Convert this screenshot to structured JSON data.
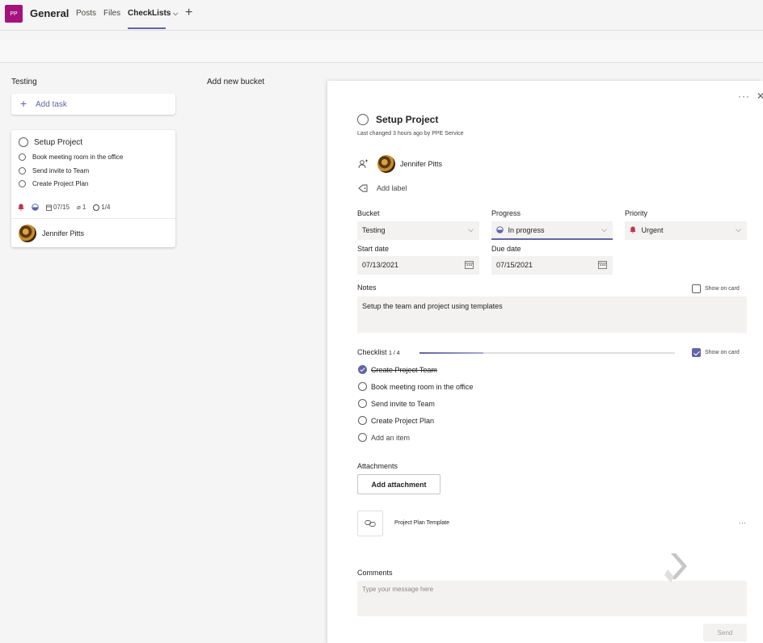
{
  "header": {
    "team_avatar": "PP",
    "team_name": "General",
    "tabs": [
      {
        "label": "Posts"
      },
      {
        "label": "Files"
      },
      {
        "label": "CheckLists"
      }
    ],
    "active_tab_chevron": "⌵",
    "add_tab": "+"
  },
  "board": {
    "bucket_name": "Testing",
    "add_bucket": "Add new bucket",
    "add_task": "Add task",
    "card": {
      "title": "Setup Project",
      "checklist": [
        "Book meeting room in the office",
        "Send invite to Team",
        "Create Project Plan"
      ],
      "due": "07/15",
      "attachments": "1",
      "checklist_count": "1/4",
      "assignee": "Jennifer Pitts"
    }
  },
  "panel": {
    "more": "···",
    "close": "✕",
    "title": "Setup Project",
    "subtitle": "Last changed 3 hours ago by PPE Service",
    "assignee": "Jennifer Pitts",
    "add_label": "Add label",
    "bucket_label": "Bucket",
    "bucket_value": "Testing",
    "progress_label": "Progress",
    "progress_value": "In progress",
    "priority_label": "Priority",
    "priority_value": "Urgent",
    "start_label": "Start date",
    "start_value": "07/13/2021",
    "due_label": "Due date",
    "due_value": "07/15/2021",
    "notes_label": "Notes",
    "show_on_card": "Show on card",
    "notes_value": "Setup the team and project using templates",
    "checklist_label": "Checklist",
    "checklist_count": "1 / 4",
    "checklist_progress": 0.25,
    "checklist_items": [
      {
        "label": "Create Project Team",
        "done": true
      },
      {
        "label": "Book meeting room in the office",
        "done": false
      },
      {
        "label": "Send invite to Team",
        "done": false
      },
      {
        "label": "Create Project Plan",
        "done": false
      }
    ],
    "add_item": "Add an item",
    "attachments_label": "Attachments",
    "add_attachment": "Add attachment",
    "attachment_name": "Project Plan Template",
    "attachment_more": "···",
    "comments_label": "Comments",
    "comment_placeholder": "Type your message here",
    "send": "Send"
  },
  "colors": {
    "accent": "#6264a7",
    "team": "#a4127d",
    "urgent": "#c4314b"
  }
}
